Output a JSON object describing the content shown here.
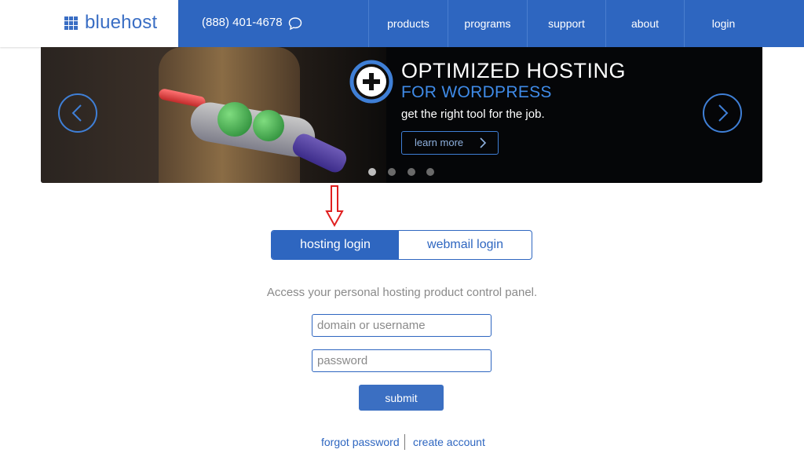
{
  "header": {
    "logo_text": "bluehost",
    "phone": "(888) 401-4678",
    "nav": [
      "products",
      "programs",
      "support",
      "about",
      "login"
    ]
  },
  "banner": {
    "title": "OPTIMIZED HOSTING",
    "subtitle": "FOR WORDPRESS",
    "tagline": "get the right tool for the job.",
    "cta_label": "learn more",
    "slide_count": 4,
    "active_slide": 1
  },
  "login": {
    "tabs": [
      "hosting login",
      "webmail login"
    ],
    "active_tab": "hosting login",
    "description": "Access your personal hosting product control panel.",
    "username_placeholder": "domain or username",
    "password_placeholder": "password",
    "submit_label": "submit",
    "forgot_label": "forgot password",
    "create_label": "create account"
  },
  "colors": {
    "brand": "#2e66c0",
    "annotation_arrow": "#e02020"
  }
}
